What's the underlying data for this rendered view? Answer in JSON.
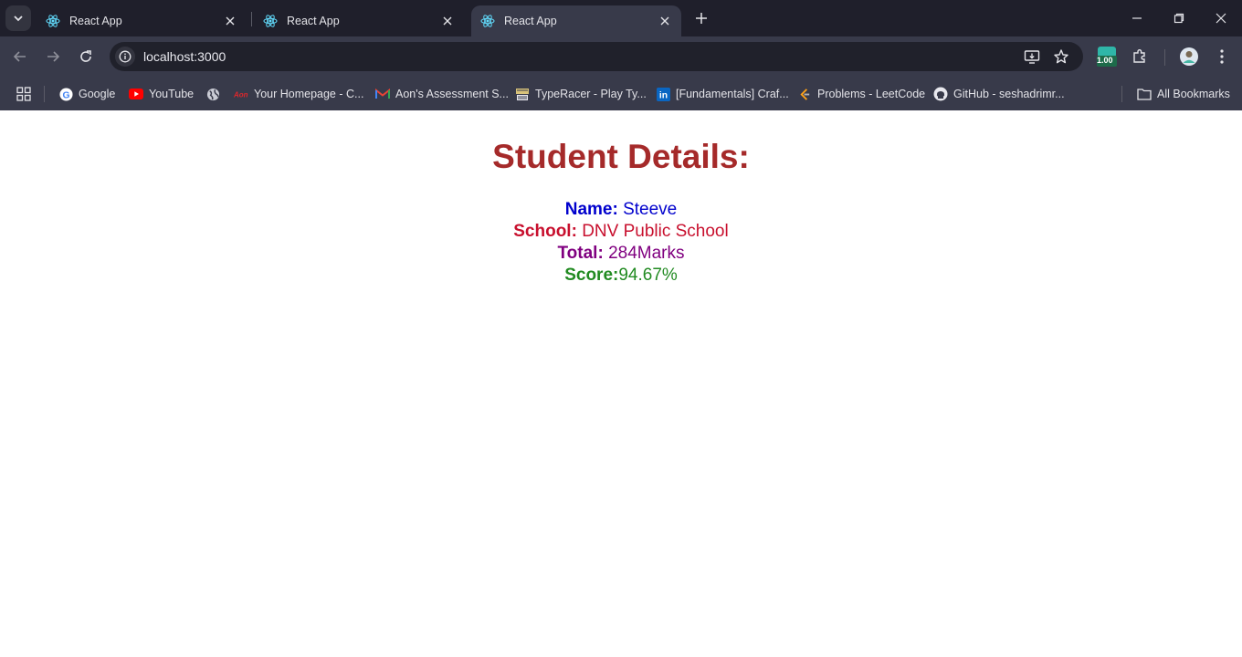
{
  "browser": {
    "tabs": [
      {
        "title": "React App",
        "active": false
      },
      {
        "title": "React App",
        "active": false
      },
      {
        "title": "React App",
        "active": true
      }
    ],
    "url": "localhost:3000",
    "extension_badge": "1.00",
    "bookmarks": [
      {
        "label": "Google",
        "icon": "google-icon"
      },
      {
        "label": "YouTube",
        "icon": "youtube-icon"
      },
      {
        "label": "",
        "icon": "globe-icon"
      },
      {
        "label": "Your Homepage - C...",
        "icon": "aon-icon"
      },
      {
        "label": "Aon's Assessment S...",
        "icon": "gmail-icon"
      },
      {
        "label": "TypeRacer - Play Ty...",
        "icon": "typeracer-icon"
      },
      {
        "label": "[Fundamentals] Craf...",
        "icon": "linkedin-icon"
      },
      {
        "label": "Problems - LeetCode",
        "icon": "leetcode-icon"
      },
      {
        "label": "GitHub - seshadrimr...",
        "icon": "github-icon"
      }
    ],
    "all_bookmarks": "All Bookmarks"
  },
  "page": {
    "heading": "Student Details:",
    "name_label": "Name:",
    "name_value": "Steeve",
    "school_label": "School:",
    "school_value": "DNV Public School",
    "total_label": "Total:",
    "total_value": "284Marks",
    "score_label": "Score:",
    "score_value": "94.67%",
    "colors": {
      "heading": "#a52a2a",
      "name": "#0000cd",
      "school": "#c8102e",
      "total": "#800080",
      "score": "#228b22"
    }
  }
}
